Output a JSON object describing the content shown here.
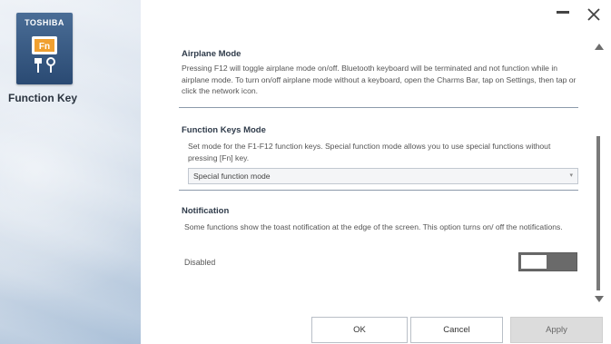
{
  "app": {
    "brand": "TOSHIBA",
    "icon_key_label": "Fn",
    "title": "Function Key"
  },
  "airplane": {
    "title": "Airplane Mode",
    "text": "Pressing F12 will toggle airplane mode on/off. Bluetooth keyboard will be terminated and not function while in airplane mode. To turn on/off airplane mode without a keyboard, open the Charms Bar, tap on Settings, then tap or click the network icon."
  },
  "function_keys": {
    "title": "Function Keys Mode",
    "text": "Set mode for the F1-F12 function keys. Special function mode allows you to use special functions without pressing [Fn] key.",
    "selected_value": "Special function mode"
  },
  "notification": {
    "title": "Notification",
    "text": "Some functions show the toast notification at the edge of the screen. This option turns on/ off the notifications.",
    "status_label": "Disabled",
    "enabled": false
  },
  "buttons": {
    "ok": "OK",
    "cancel": "Cancel",
    "apply": "Apply"
  },
  "colors": {
    "icon_bg": "#2a4a73",
    "key_accent": "#f0a030",
    "toggle_bg": "#6a6a6a"
  }
}
